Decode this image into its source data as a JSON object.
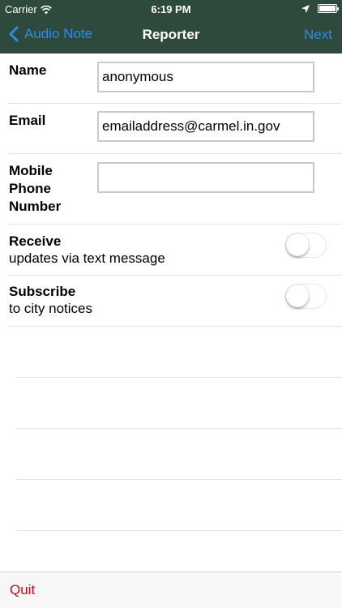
{
  "status_bar": {
    "carrier": "Carrier",
    "time": "6:19 PM"
  },
  "nav": {
    "back_label": "Audio Note",
    "title": "Reporter",
    "next_label": "Next"
  },
  "form": {
    "name": {
      "label": "Name",
      "value": "anonymous"
    },
    "email": {
      "label": "Email",
      "value": "emailaddress@carmel.in.gov"
    },
    "phone": {
      "label_line1": "Mobile",
      "label_line2": "Phone",
      "label_line3": "Number",
      "value": ""
    }
  },
  "toggles": {
    "receive": {
      "title": "Receive",
      "subtitle": "updates via text message",
      "on": false
    },
    "subscribe": {
      "title": "Subscribe",
      "subtitle": "to city notices",
      "on": false
    }
  },
  "toolbar": {
    "quit_label": "Quit"
  },
  "colors": {
    "nav_background": "#2e4a3c",
    "nav_button": "#2f8ce6",
    "quit": "#d0021b"
  },
  "icons": [
    "wifi-icon",
    "location-arrow-icon",
    "battery-icon",
    "chevron-left-icon"
  ]
}
